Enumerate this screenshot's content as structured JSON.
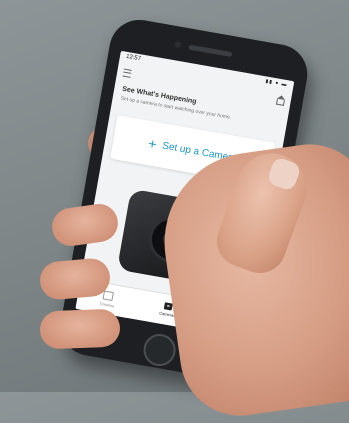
{
  "phone": {
    "status_time": "12:57",
    "status_icons": "▮▮ ● ▬",
    "header": {
      "title": "See What's Happening",
      "subtitle": "Set up a camera to start watching over your home."
    },
    "setup_card": {
      "plus": "+",
      "label": "Set up a Camera"
    },
    "tabs": [
      {
        "label": "Timeline",
        "icon": "timeline-icon"
      },
      {
        "label": "Cameras",
        "icon": "cameras-icon",
        "active": true
      },
      {
        "label": "",
        "icon": "more-icon"
      }
    ]
  },
  "colors": {
    "accent": "#1c98c7",
    "background": "#f2f3f4"
  }
}
